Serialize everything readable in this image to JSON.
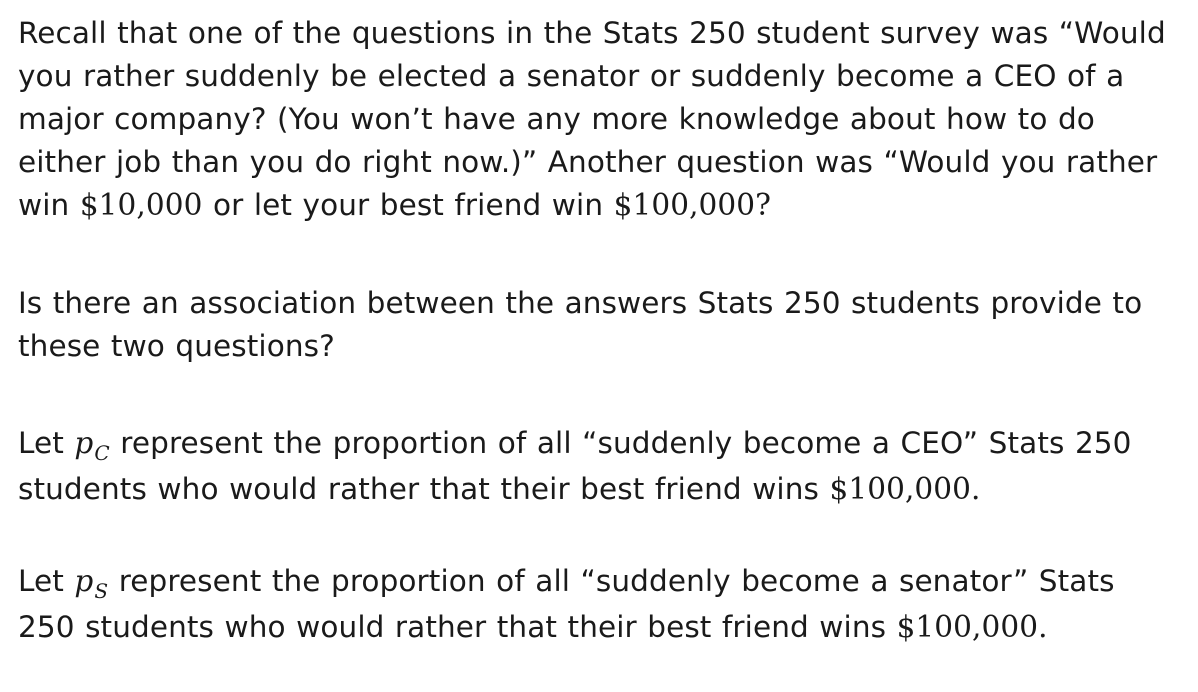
{
  "paragraph_1": {
    "text_before_money_1": "Recall that one of the questions in the Stats 250 student survey was “Would you rather suddenly be elected a senator or suddenly become a CEO of a major company? (You won’t have any more knowledge about how to do either job than you do right now.)” Another question was “Would you rather win ",
    "money_1": "$10,000",
    "text_middle": " or let your best friend win ",
    "money_2": "$100,000",
    "text_end": "?"
  },
  "paragraph_2": {
    "text": "Is there an association between the answers Stats 250 students provide to these two questions?"
  },
  "paragraph_3": {
    "prefix": "Let ",
    "variable": "p",
    "subscript": "C",
    "text_middle": " represent the proportion of all “suddenly become a CEO” Stats 250 students who would rather that their best friend wins ",
    "money": "$100,000",
    "suffix": "."
  },
  "paragraph_4": {
    "prefix": "Let ",
    "variable": "p",
    "subscript": "S",
    "text_middle": " represent the proportion of all “suddenly become a senator” Stats 250 students who would rather that their best friend wins ",
    "money": "$100,000",
    "suffix": "."
  }
}
